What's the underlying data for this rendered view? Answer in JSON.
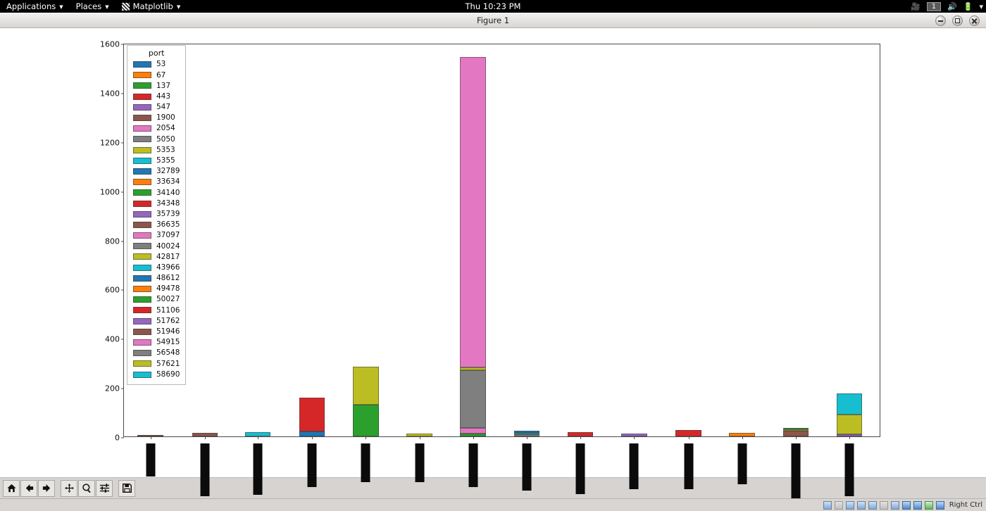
{
  "desktop": {
    "menus": [
      {
        "label": "Applications",
        "icon": "none"
      },
      {
        "label": "Places",
        "icon": "none"
      },
      {
        "label": "Matplotlib",
        "icon": "matplotlib-icon"
      }
    ],
    "clock": "Thu 10:23 PM",
    "workspace": "1",
    "tray_icons": [
      "screencast-icon",
      "volume-icon",
      "battery-icon",
      "chevron-down-icon"
    ]
  },
  "window": {
    "title": "Figure 1",
    "buttons": [
      "minimize",
      "maximize",
      "close"
    ]
  },
  "toolbar": {
    "buttons": [
      {
        "name": "home-icon",
        "tooltip": "Home"
      },
      {
        "name": "back-arrow-icon",
        "tooltip": "Back"
      },
      {
        "name": "forward-arrow-icon",
        "tooltip": "Forward"
      },
      {
        "name": "pan-icon",
        "tooltip": "Pan"
      },
      {
        "name": "zoom-magnifier-icon",
        "tooltip": "Zoom to rectangle"
      },
      {
        "name": "subplot-config-icon",
        "tooltip": "Configure subplots"
      },
      {
        "name": "save-floppy-icon",
        "tooltip": "Save the figure"
      }
    ]
  },
  "statusbar": {
    "host_key": "Right Ctrl",
    "icons": [
      "hard-disk-icon",
      "optical-disk-icon",
      "floppy-icon",
      "network-icon",
      "usb-icon",
      "shared-folder-icon",
      "display-icon",
      "recording-icon",
      "mouse-icon",
      "keyboard-icon",
      "host-key-icon"
    ]
  },
  "chart_data": {
    "type": "bar",
    "barmode": "stacked",
    "title": "",
    "xlabel": "",
    "ylabel": "",
    "ylim": [
      0,
      1600
    ],
    "yticks": [
      0,
      200,
      400,
      600,
      800,
      1000,
      1200,
      1400,
      1600
    ],
    "grid": false,
    "legend": {
      "title": "port",
      "position": "upper left",
      "entries": [
        {
          "label": "53",
          "color": "#1f77b4"
        },
        {
          "label": "67",
          "color": "#ff7f0e"
        },
        {
          "label": "137",
          "color": "#2ca02c"
        },
        {
          "label": "443",
          "color": "#d62728"
        },
        {
          "label": "547",
          "color": "#9467bd"
        },
        {
          "label": "1900",
          "color": "#8c564b"
        },
        {
          "label": "2054",
          "color": "#e377c2"
        },
        {
          "label": "5050",
          "color": "#7f7f7f"
        },
        {
          "label": "5353",
          "color": "#bcbd22"
        },
        {
          "label": "5355",
          "color": "#17becf"
        },
        {
          "label": "32789",
          "color": "#1f77b4"
        },
        {
          "label": "33634",
          "color": "#ff7f0e"
        },
        {
          "label": "34140",
          "color": "#2ca02c"
        },
        {
          "label": "34348",
          "color": "#d62728"
        },
        {
          "label": "35739",
          "color": "#9467bd"
        },
        {
          "label": "36635",
          "color": "#8c564b"
        },
        {
          "label": "37097",
          "color": "#e377c2"
        },
        {
          "label": "40024",
          "color": "#7f7f7f"
        },
        {
          "label": "42817",
          "color": "#bcbd22"
        },
        {
          "label": "43966",
          "color": "#17becf"
        },
        {
          "label": "48612",
          "color": "#1f77b4"
        },
        {
          "label": "49478",
          "color": "#ff7f0e"
        },
        {
          "label": "50027",
          "color": "#2ca02c"
        },
        {
          "label": "51106",
          "color": "#d62728"
        },
        {
          "label": "51762",
          "color": "#9467bd"
        },
        {
          "label": "51946",
          "color": "#8c564b"
        },
        {
          "label": "54915",
          "color": "#e377c2"
        },
        {
          "label": "56548",
          "color": "#7f7f7f"
        },
        {
          "label": "57621",
          "color": "#bcbd22"
        },
        {
          "label": "58690",
          "color": "#17becf"
        }
      ]
    },
    "categories": [
      "redacted-1",
      "redacted-2",
      "redacted-3",
      "redacted-4",
      "redacted-5",
      "redacted-6",
      "redacted-7",
      "redacted-8",
      "redacted-9",
      "redacted-10",
      "redacted-11",
      "redacted-12",
      "redacted-13",
      "redacted-14"
    ],
    "xtick_labels_redacted": true,
    "bars": [
      {
        "center_pct": 3.5,
        "width_pct": 3.4,
        "total": 4,
        "segments": [
          {
            "port": "1900",
            "color": "#8c564b",
            "value": 4
          }
        ]
      },
      {
        "center_pct": 10.7,
        "width_pct": 3.4,
        "total": 14,
        "segments": [
          {
            "port": "1900",
            "color": "#8c564b",
            "value": 14
          }
        ]
      },
      {
        "center_pct": 17.7,
        "width_pct": 3.4,
        "total": 18,
        "segments": [
          {
            "port": "5355",
            "color": "#17becf",
            "value": 18
          }
        ]
      },
      {
        "center_pct": 24.9,
        "width_pct": 3.4,
        "total": 158,
        "segments": [
          {
            "port": "53",
            "color": "#1f77b4",
            "value": 20
          },
          {
            "port": "443",
            "color": "#d62728",
            "value": 138
          }
        ]
      },
      {
        "center_pct": 32.0,
        "width_pct": 3.4,
        "total": 282,
        "segments": [
          {
            "port": "137",
            "color": "#2ca02c",
            "value": 128
          },
          {
            "port": "5353",
            "color": "#bcbd22",
            "value": 154
          }
        ]
      },
      {
        "center_pct": 39.1,
        "width_pct": 3.4,
        "total": 12,
        "segments": [
          {
            "port": "5353",
            "color": "#bcbd22",
            "value": 12
          }
        ]
      },
      {
        "center_pct": 46.2,
        "width_pct": 3.4,
        "total": 1542,
        "segments": [
          {
            "port": "137",
            "color": "#2ca02c",
            "value": 12
          },
          {
            "port": "2054",
            "color": "#e377c2",
            "value": 22
          },
          {
            "port": "5050",
            "color": "#7f7f7f",
            "value": 236
          },
          {
            "port": "5353",
            "color": "#bcbd22",
            "value": 10
          },
          {
            "port": "37097",
            "color": "#e377c2",
            "value": 1262
          }
        ]
      },
      {
        "center_pct": 53.3,
        "width_pct": 3.4,
        "total": 22,
        "segments": [
          {
            "port": "5050",
            "color": "#7f7f7f",
            "value": 8
          },
          {
            "port": "5355",
            "color": "#17becf",
            "value": 7
          },
          {
            "port": "32789",
            "color": "#1f77b4",
            "value": 7
          }
        ]
      },
      {
        "center_pct": 60.4,
        "width_pct": 3.4,
        "total": 18,
        "segments": [
          {
            "port": "443",
            "color": "#d62728",
            "value": 18
          }
        ]
      },
      {
        "center_pct": 67.5,
        "width_pct": 3.4,
        "total": 12,
        "segments": [
          {
            "port": "547",
            "color": "#9467bd",
            "value": 12
          }
        ]
      },
      {
        "center_pct": 74.7,
        "width_pct": 3.4,
        "total": 26,
        "segments": [
          {
            "port": "443",
            "color": "#d62728",
            "value": 26
          }
        ]
      },
      {
        "center_pct": 81.8,
        "width_pct": 3.4,
        "total": 14,
        "segments": [
          {
            "port": "67",
            "color": "#ff7f0e",
            "value": 14
          }
        ]
      },
      {
        "center_pct": 88.9,
        "width_pct": 3.4,
        "total": 34,
        "segments": [
          {
            "port": "1900",
            "color": "#8c564b",
            "value": 22
          },
          {
            "port": "5353",
            "color": "#bcbd22",
            "value": 7
          },
          {
            "port": "34140",
            "color": "#2ca02c",
            "value": 5
          }
        ]
      },
      {
        "center_pct": 96.0,
        "width_pct": 3.4,
        "total": 176,
        "segments": [
          {
            "port": "547",
            "color": "#9467bd",
            "value": 8
          },
          {
            "port": "57621",
            "color": "#bcbd22",
            "value": 82
          },
          {
            "port": "58690",
            "color": "#17becf",
            "value": 86
          }
        ]
      }
    ]
  }
}
